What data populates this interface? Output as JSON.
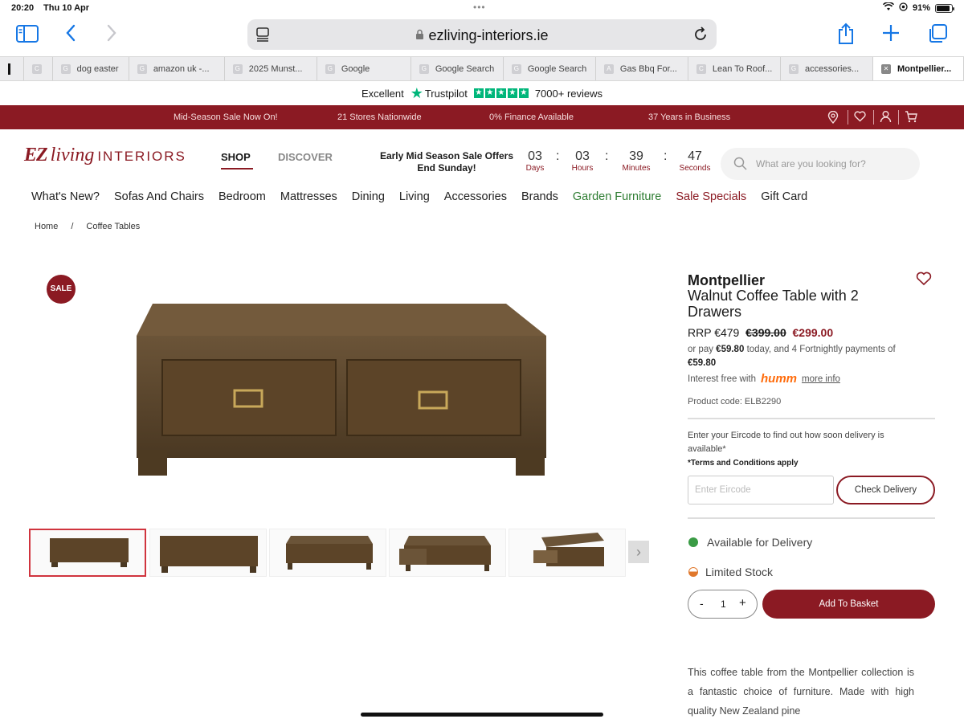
{
  "status": {
    "time": "20:20",
    "date": "Thu 10 Apr",
    "battery": "91%"
  },
  "browser": {
    "url": "ezliving-interiors.ie",
    "tabs": [
      {
        "fav": "",
        "label": ""
      },
      {
        "fav": "C",
        "label": ""
      },
      {
        "fav": "G",
        "label": "dog easter"
      },
      {
        "fav": "G",
        "label": "amazon uk -..."
      },
      {
        "fav": "G",
        "label": "2025 Munst..."
      },
      {
        "fav": "G",
        "label": "Google"
      },
      {
        "fav": "G",
        "label": "Google Search"
      },
      {
        "fav": "G",
        "label": "Google Search"
      },
      {
        "fav": "A",
        "label": "Gas Bbq For..."
      },
      {
        "fav": "C",
        "label": "Lean To Roof..."
      },
      {
        "fav": "G",
        "label": "accessories..."
      },
      {
        "fav": "✕",
        "label": "Montpellier..."
      }
    ]
  },
  "trustpilot": {
    "rating_word": "Excellent",
    "brand": "Trustpilot",
    "reviews": "7000+ reviews"
  },
  "promo": {
    "items": [
      "Mid-Season Sale Now On!",
      "21 Stores Nationwide",
      "0% Finance Available",
      "37 Years in Business"
    ]
  },
  "header": {
    "logo_ez": "EZ",
    "logo_living": "living",
    "logo_interiors": "INTERIORS",
    "nav_shop": "SHOP",
    "nav_discover": "DISCOVER",
    "offer_line1": "Early Mid Season Sale Offers",
    "offer_line2": "End Sunday!",
    "countdown": [
      {
        "num": "03",
        "label": "Days"
      },
      {
        "num": "03",
        "label": "Hours"
      },
      {
        "num": "39",
        "label": "Minutes"
      },
      {
        "num": "47",
        "label": "Seconds"
      }
    ],
    "search_placeholder": "What are you looking for?"
  },
  "categories": [
    "What's New?",
    "Sofas And Chairs",
    "Bedroom",
    "Mattresses",
    "Dining",
    "Living",
    "Accessories",
    "Brands",
    "Garden Furniture",
    "Sale Specials",
    "Gift Card"
  ],
  "breadcrumb": {
    "home": "Home",
    "sep": "/",
    "current": "Coffee Tables"
  },
  "product": {
    "sale_badge": "SALE",
    "title_line1": "Montpellier",
    "title_line2": "Walnut Coffee Table with 2",
    "title_line3": "Drawers",
    "rrp": "RRP €479",
    "was_price": "€399.00",
    "price": "€299.00",
    "pay_prefix": "or pay",
    "pay_amount": "€59.80",
    "pay_suffix": "today, and 4 Fortnightly payments of",
    "pay_fortnightly": "€59.80",
    "interest": "Interest free with",
    "humm": "humm",
    "more_info": "more info",
    "product_code": "Product code: ELB2290",
    "eircode_text": "Enter your Eircode to find out how soon delivery is available*",
    "terms": "*Terms and Conditions apply",
    "eircode_placeholder": "Enter Eircode",
    "check_delivery": "Check Delivery",
    "availability": "Available for Delivery",
    "stock": "Limited Stock",
    "qty_minus": "-",
    "qty": "1",
    "qty_plus": "+",
    "add_to_basket": "Add To Basket",
    "description": "This coffee table from the Montpellier collection is a fantastic choice of furniture. Made with high quality New Zealand pine"
  },
  "colors": {
    "brand": "#8b1a23",
    "green": "#2e7d32",
    "safari_blue": "#1677e5"
  }
}
